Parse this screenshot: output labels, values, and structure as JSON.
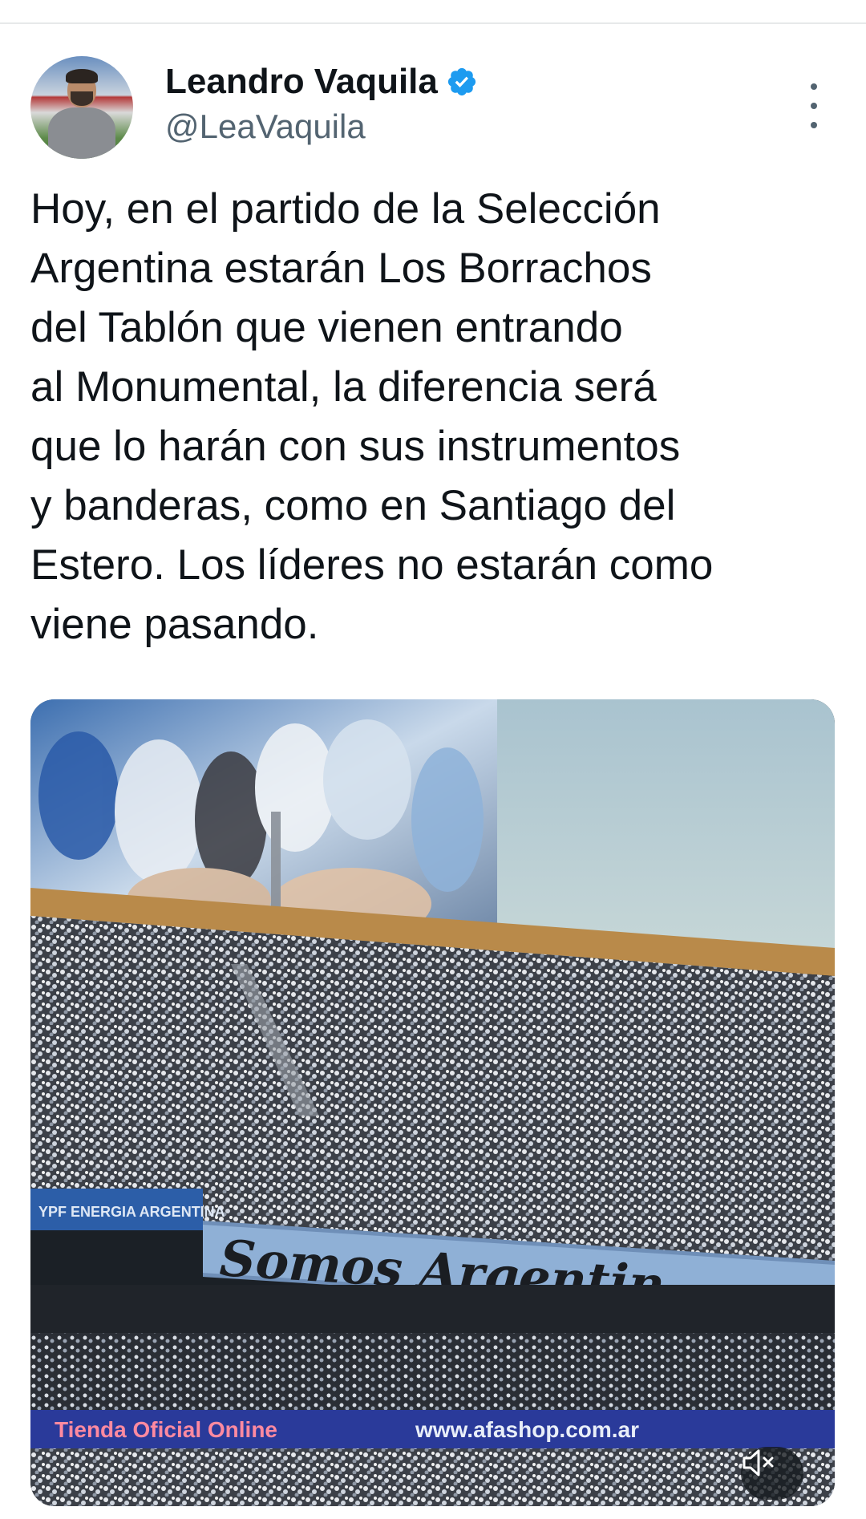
{
  "author": {
    "display_name": "Leandro Vaquila",
    "handle": "@LeaVaquila",
    "verified": true
  },
  "tweet": {
    "text_lines": [
      "Hoy, en el partido de la Selección",
      "Argentina estarán Los Borrachos",
      "del Tablón que vienen entrando",
      "al Monumental, la diferencia será",
      "que lo harán con sus instrumentos",
      "y banderas, como en Santiago del",
      "Estero. Los líderes no estarán como",
      "viene pasando."
    ]
  },
  "media": {
    "type": "video",
    "banner_text": "Somos Argentin",
    "sponsor_text": "YPF ENERGIA ARGENTINA",
    "ad_left_text": "Tienda Oficial Online",
    "ad_right_text": "www.afashop.com.ar",
    "mute_icon": "volume-muted-icon"
  },
  "icons": {
    "verified": "verified-badge-icon",
    "more": "more-options-icon"
  },
  "colors": {
    "verified_blue": "#1d9bf0",
    "text_primary": "#0f1419",
    "text_secondary": "#536471",
    "divider": "#e7e9ea"
  }
}
